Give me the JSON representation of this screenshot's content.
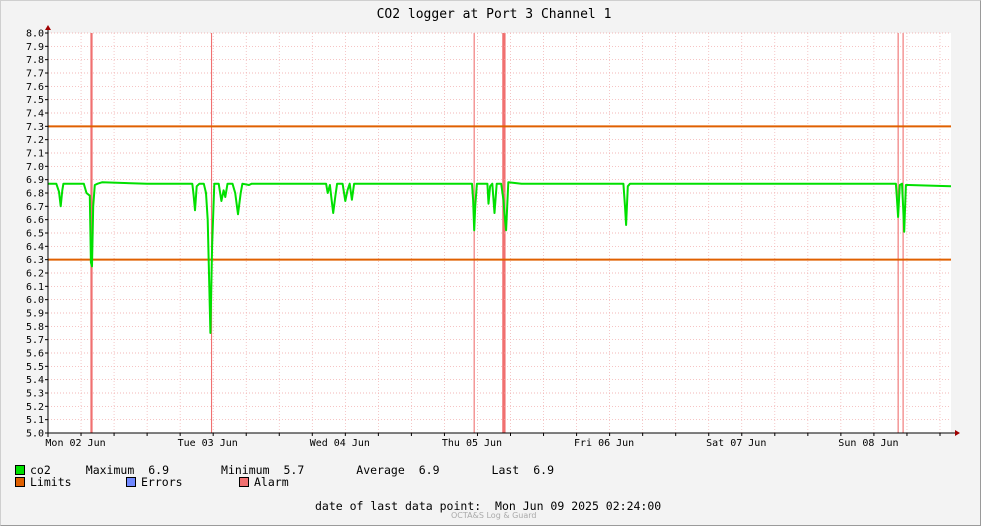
{
  "chart_data": {
    "type": "line",
    "title": "CO2 logger at Port 3 Channel 1",
    "y_axis": {
      "min": 5.0,
      "max": 8.0,
      "ticks": [
        "5.0",
        "5.1",
        "5.2",
        "5.3",
        "5.4",
        "5.5",
        "5.6",
        "5.7",
        "5.8",
        "5.9",
        "6.0",
        "6.1",
        "6.2",
        "6.3",
        "6.4",
        "6.5",
        "6.6",
        "6.7",
        "6.8",
        "6.9",
        "7.0",
        "7.1",
        "7.2",
        "7.3",
        "7.4",
        "7.5",
        "7.6",
        "7.7",
        "7.8",
        "7.9",
        "8.0"
      ]
    },
    "x_axis": {
      "min_hours": 0,
      "max_hours": 164,
      "day_labels": [
        {
          "label": "Mon 02 Jun",
          "hour": 5
        },
        {
          "label": "Tue 03 Jun",
          "hour": 29
        },
        {
          "label": "Wed 04 Jun",
          "hour": 53
        },
        {
          "label": "Thu 05 Jun",
          "hour": 77
        },
        {
          "label": "Fri 06 Jun",
          "hour": 101
        },
        {
          "label": "Sat 07 Jun",
          "hour": 125
        },
        {
          "label": "Sun 08 Jun",
          "hour": 149
        }
      ]
    },
    "grid": true,
    "limits": [
      7.3,
      6.3
    ],
    "alarm_bands": [
      [
        7.7,
        8.1
      ],
      [
        29.6,
        29.8
      ],
      [
        77.3,
        77.5
      ],
      [
        82.5,
        83.1
      ],
      [
        154.3,
        154.5
      ],
      [
        155.2,
        155.4
      ]
    ],
    "series": [
      {
        "name": "co2",
        "color": "#00e000",
        "points": [
          [
            0,
            6.87
          ],
          [
            1.5,
            6.87
          ],
          [
            2.0,
            6.81
          ],
          [
            2.3,
            6.7
          ],
          [
            2.6,
            6.82
          ],
          [
            2.8,
            6.87
          ],
          [
            6.5,
            6.87
          ],
          [
            7.0,
            6.8
          ],
          [
            7.6,
            6.78
          ],
          [
            7.8,
            6.28
          ],
          [
            8.0,
            6.25
          ],
          [
            8.2,
            6.7
          ],
          [
            8.5,
            6.86
          ],
          [
            9.0,
            6.87
          ],
          [
            9.8,
            6.88
          ],
          [
            18,
            6.87
          ],
          [
            26.2,
            6.87
          ],
          [
            26.4,
            6.8
          ],
          [
            26.7,
            6.67
          ],
          [
            27.0,
            6.85
          ],
          [
            27.5,
            6.87
          ],
          [
            28.3,
            6.87
          ],
          [
            28.7,
            6.8
          ],
          [
            29.0,
            6.6
          ],
          [
            29.3,
            6.1
          ],
          [
            29.5,
            5.75
          ],
          [
            29.8,
            6.4
          ],
          [
            30.2,
            6.87
          ],
          [
            31.0,
            6.87
          ],
          [
            31.5,
            6.74
          ],
          [
            31.9,
            6.82
          ],
          [
            32.2,
            6.77
          ],
          [
            32.6,
            6.87
          ],
          [
            33.5,
            6.87
          ],
          [
            34.0,
            6.8
          ],
          [
            34.5,
            6.64
          ],
          [
            35.0,
            6.8
          ],
          [
            35.3,
            6.87
          ],
          [
            36.5,
            6.86
          ],
          [
            37,
            6.87
          ],
          [
            50.5,
            6.87
          ],
          [
            50.8,
            6.8
          ],
          [
            51.2,
            6.86
          ],
          [
            51.5,
            6.75
          ],
          [
            51.8,
            6.65
          ],
          [
            52.2,
            6.78
          ],
          [
            52.5,
            6.87
          ],
          [
            53.5,
            6.87
          ],
          [
            54.0,
            6.74
          ],
          [
            54.4,
            6.82
          ],
          [
            54.8,
            6.87
          ],
          [
            55.2,
            6.75
          ],
          [
            55.6,
            6.87
          ],
          [
            65,
            6.87
          ],
          [
            77.0,
            6.87
          ],
          [
            77.2,
            6.75
          ],
          [
            77.4,
            6.52
          ],
          [
            77.6,
            6.71
          ],
          [
            77.9,
            6.87
          ],
          [
            79.8,
            6.87
          ],
          [
            80.0,
            6.72
          ],
          [
            80.3,
            6.85
          ],
          [
            80.7,
            6.87
          ],
          [
            81.1,
            6.65
          ],
          [
            81.5,
            6.87
          ],
          [
            82.3,
            6.87
          ],
          [
            82.7,
            6.75
          ],
          [
            83.0,
            6.6
          ],
          [
            83.2,
            6.52
          ],
          [
            83.6,
            6.88
          ],
          [
            86,
            6.87
          ],
          [
            100,
            6.87
          ],
          [
            104.5,
            6.87
          ],
          [
            104.8,
            6.7
          ],
          [
            105.0,
            6.56
          ],
          [
            105.3,
            6.85
          ],
          [
            105.7,
            6.87
          ],
          [
            120,
            6.87
          ],
          [
            135,
            6.87
          ],
          [
            154.0,
            6.87
          ],
          [
            154.2,
            6.75
          ],
          [
            154.4,
            6.62
          ],
          [
            154.7,
            6.86
          ],
          [
            155.1,
            6.87
          ],
          [
            155.3,
            6.7
          ],
          [
            155.5,
            6.51
          ],
          [
            155.8,
            6.86
          ],
          [
            156.3,
            6.86
          ],
          [
            164,
            6.85
          ]
        ]
      }
    ]
  },
  "legend": {
    "series_label": "co2",
    "maximum_label": "Maximum",
    "maximum_value": "6.9",
    "minimum_label": "Minimum",
    "minimum_value": "5.7",
    "average_label": "Average",
    "average_value": "6.9",
    "last_label": "Last",
    "last_value": "6.9",
    "limits_label": "Limits",
    "errors_label": "Errors",
    "alarm_label": "Alarm"
  },
  "colors": {
    "co2": "#00e000",
    "limits": "#e06000",
    "errors": "#7088ff",
    "alarm": "#f07070"
  },
  "footer": {
    "date_label": "date of last data point:",
    "date_value": "Mon Jun 09 2025 02:24:00",
    "watermark": "OCTA&S Log & Guard"
  }
}
